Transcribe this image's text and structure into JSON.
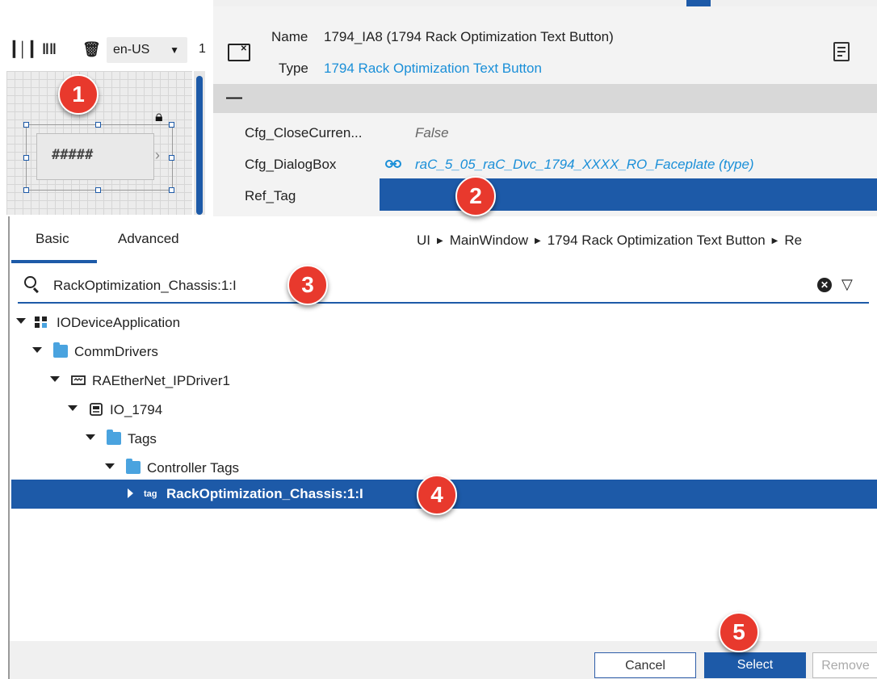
{
  "left_toolbar": {
    "icons": [
      "align-bottom-icon",
      "distribute-vertical-icon",
      "trash-icon"
    ],
    "language": "en-US",
    "extra": "1"
  },
  "canvas": {
    "placeholder_text": "#####"
  },
  "properties": {
    "name_label": "Name",
    "name_value": "1794_IA8 (1794 Rack Optimization Text Button)",
    "type_label": "Type",
    "type_value": "1794 Rack Optimization Text Button",
    "collapse_symbol": "—",
    "rows": [
      {
        "label": "Cfg_CloseCurren...",
        "value": "False"
      },
      {
        "label": "Cfg_DialogBox",
        "value": "raC_5_05_raC_Dvc_1794_XXXX_RO_Faceplate (type)"
      },
      {
        "label": "Ref_Tag",
        "value": ""
      }
    ]
  },
  "dialog": {
    "tabs": [
      "Basic",
      "Advanced"
    ],
    "breadcrumb": [
      "UI",
      "MainWindow",
      "1794 Rack Optimization Text Button",
      "Re"
    ],
    "search_value": "RackOptimization_Chassis:1:I",
    "tree": [
      {
        "label": "IODeviceApplication",
        "icon": "application-icon"
      },
      {
        "label": "CommDrivers",
        "icon": "comm-folder-icon"
      },
      {
        "label": "RAEtherNet_IPDriver1",
        "icon": "network-driver-icon"
      },
      {
        "label": "IO_1794",
        "icon": "io-module-icon"
      },
      {
        "label": "Tags",
        "icon": "folder-icon"
      },
      {
        "label": "Controller Tags",
        "icon": "folder-icon"
      },
      {
        "label": "RackOptimization_Chassis:1:I",
        "icon": "tag-icon",
        "tag_prefix": "tag"
      }
    ],
    "buttons": {
      "cancel": "Cancel",
      "select": "Select",
      "remove": "Remove"
    }
  },
  "callouts": [
    "1",
    "2",
    "3",
    "4",
    "5"
  ],
  "colors": {
    "accent": "#1d5aa8",
    "link": "#1a8fd8",
    "callout": "#e8392d"
  }
}
